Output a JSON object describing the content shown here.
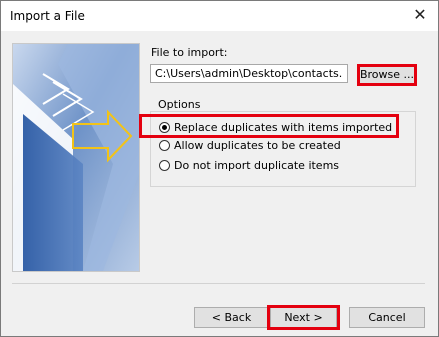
{
  "window": {
    "title": "Import a File",
    "close_glyph": "✕"
  },
  "file": {
    "label": "File to import:",
    "path_value": "C:\\Users\\admin\\Desktop\\contacts.",
    "browse_label": "Browse ..."
  },
  "options": {
    "legend": "Options",
    "items": [
      {
        "label": "Replace duplicates with items imported",
        "checked": true
      },
      {
        "label": "Allow duplicates to be created",
        "checked": false
      },
      {
        "label": "Do not import duplicate items",
        "checked": false
      }
    ]
  },
  "footer": {
    "back_label": "< Back",
    "next_label": "Next >",
    "cancel_label": "Cancel"
  },
  "highlight_color": "#e4000f"
}
